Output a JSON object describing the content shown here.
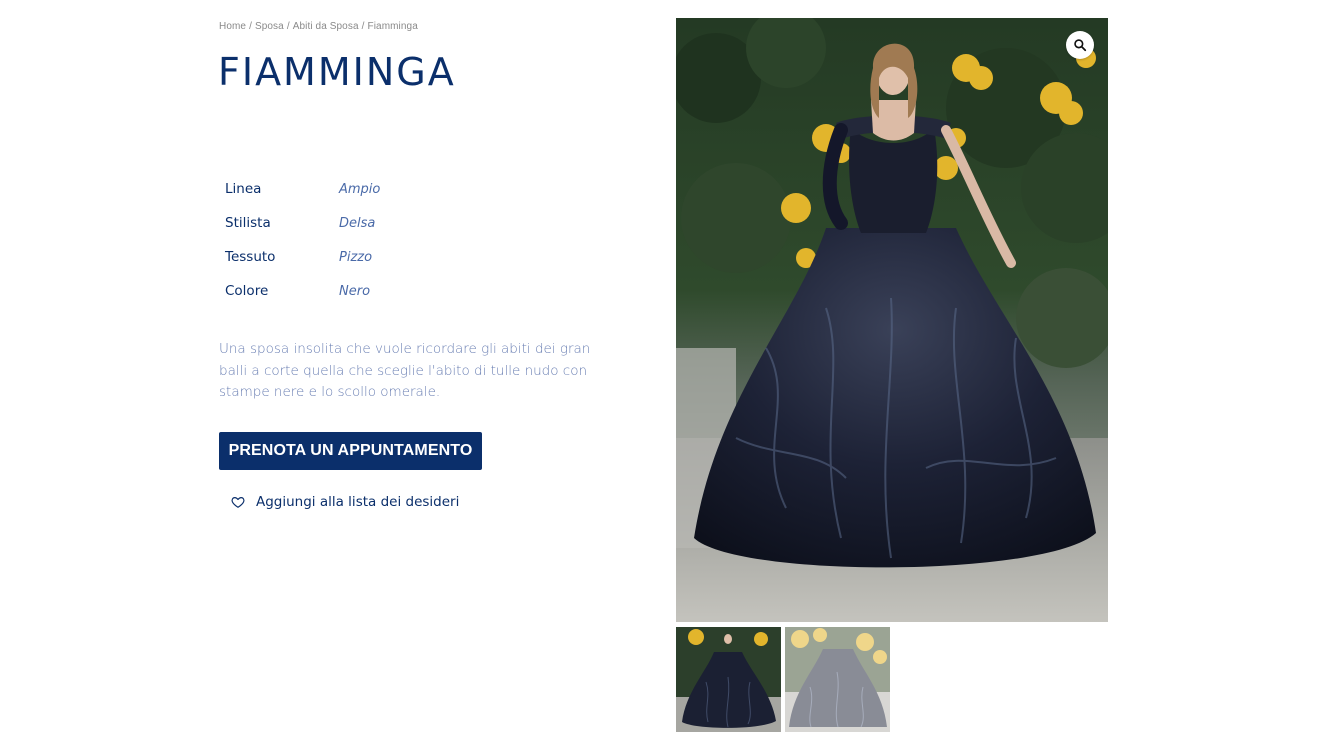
{
  "breadcrumb": {
    "items": [
      "Home",
      "Sposa",
      "Abiti da Sposa",
      "Fiamminga"
    ],
    "separator": "/"
  },
  "product": {
    "title": "FIAMMINGA",
    "specs": [
      {
        "label": "Linea",
        "value": "Ampio"
      },
      {
        "label": "Stilista",
        "value": "Delsa"
      },
      {
        "label": "Tessuto",
        "value": "Pizzo"
      },
      {
        "label": "Colore",
        "value": "Nero"
      }
    ],
    "description": "Una sposa insolita che vuole ricordare gli abiti dei gran balli a corte quella che sceglie l'abito di tulle nudo con stampe nere e lo scollo omerale."
  },
  "actions": {
    "book_label": "PRENOTA UN APPUNTAMENTO",
    "wishlist_label": "Aggiungi alla lista dei desideri",
    "wishlist_icon": "heart-outline-icon"
  },
  "gallery": {
    "zoom_icon": "magnifier-icon",
    "thumbnails_count": 2,
    "active_thumbnail": 1
  },
  "colors": {
    "brand_navy": "#0b2f6b",
    "spec_value": "#4a6aa8",
    "description_text": "#6a7fb3",
    "breadcrumb_text": "#8a8a8a"
  }
}
